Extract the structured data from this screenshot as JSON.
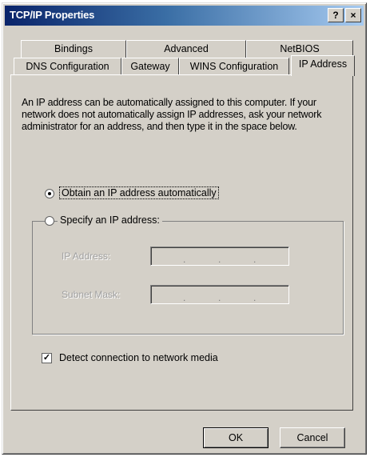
{
  "window": {
    "title": "TCP/IP Properties",
    "help_label": "?",
    "close_label": "×"
  },
  "tabs": {
    "row1": [
      "Bindings",
      "Advanced",
      "NetBIOS"
    ],
    "row2": [
      "DNS Configuration",
      "Gateway",
      "WINS Configuration",
      "IP Address"
    ],
    "active": "IP Address"
  },
  "description": "An IP address can be automatically assigned to this computer. If your network does not automatically assign IP addresses, ask your network administrator for an address, and then type it in the space below.",
  "options": {
    "auto_label": "Obtain an IP address automatically",
    "auto_selected": true,
    "specify_label": "Specify an IP address:",
    "specify_selected": false
  },
  "fields": {
    "ip_label": "IP Address:",
    "subnet_label": "Subnet Mask:",
    "separator": "."
  },
  "detect": {
    "label": "Detect connection to network media",
    "checked": true,
    "check_glyph": "✓"
  },
  "buttons": {
    "ok": "OK",
    "cancel": "Cancel"
  }
}
